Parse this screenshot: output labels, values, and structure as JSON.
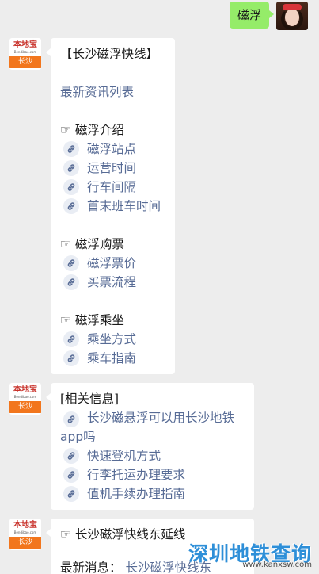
{
  "sent": {
    "text": "磁浮"
  },
  "brand": {
    "name": "本地宝",
    "url": "Bendibao.com",
    "city": "长沙"
  },
  "msg1": {
    "title": "【长沙磁浮快线】",
    "latest_link": "最新资讯列表",
    "sections": [
      {
        "header": "☞ 磁浮介绍",
        "items": [
          "磁浮站点",
          "运营时间",
          "行车间隔",
          "首末班车时间"
        ]
      },
      {
        "header": "☞ 磁浮购票",
        "items": [
          "磁浮票价",
          "买票流程"
        ]
      },
      {
        "header": "☞ 磁浮乘坐",
        "items": [
          "乘坐方式",
          "乘车指南"
        ]
      }
    ]
  },
  "msg2": {
    "title": "[相关信息]",
    "items": [
      "长沙磁悬浮可以用长沙地铁app吗",
      "快速登机方式",
      "行李托运办理要求",
      "值机手续办理指南"
    ]
  },
  "msg3": {
    "line1": "☞ 长沙磁浮快线东延线",
    "line2_prefix": "最新消息：",
    "line2_link": "长沙磁浮快线东"
  },
  "watermark": {
    "text": "深圳地铁查询",
    "url": "www.kanxsw.com"
  },
  "colors": {
    "sent_bubble": "#95ec69",
    "link": "#576b95",
    "background": "#ededed",
    "badge": "#f2761d"
  }
}
